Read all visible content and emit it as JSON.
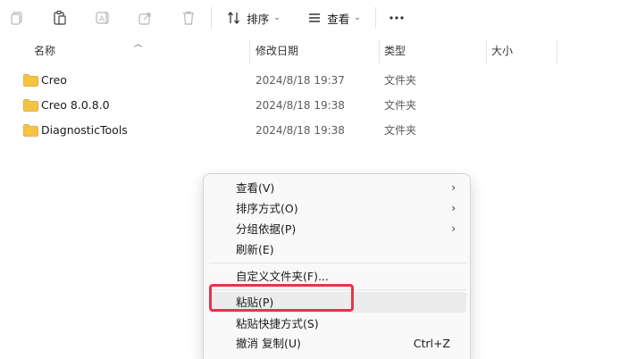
{
  "toolbar": {
    "sort_label": "排序",
    "view_label": "查看",
    "icons": [
      "copy-icon",
      "paste-icon",
      "rename-icon",
      "share-icon",
      "delete-icon",
      "sort-icon",
      "view-icon",
      "more-icon"
    ]
  },
  "columns": {
    "name": "名称",
    "date": "修改日期",
    "type": "类型",
    "size": "大小"
  },
  "files": [
    {
      "name": "Creo",
      "date": "2024/8/18 19:37",
      "type": "文件夹"
    },
    {
      "name": "Creo 8.0.8.0",
      "date": "2024/8/18 19:38",
      "type": "文件夹"
    },
    {
      "name": "DiagnosticTools",
      "date": "2024/8/18 19:38",
      "type": "文件夹"
    }
  ],
  "context_menu": {
    "view": "查看(V)",
    "sort_by": "排序方式(O)",
    "group_by": "分组依据(P)",
    "refresh": "刷新(E)",
    "customize": "自定义文件夹(F)...",
    "paste": "粘贴(P)",
    "paste_shortcut": "粘贴快捷方式(S)",
    "undo_copy": "撤消 复制(U)",
    "undo_shortcut": "Ctrl+Z"
  },
  "colors": {
    "folder": "#f5c342",
    "highlight_border": "#e2364a",
    "menu_bg": "#f9f9f9"
  }
}
